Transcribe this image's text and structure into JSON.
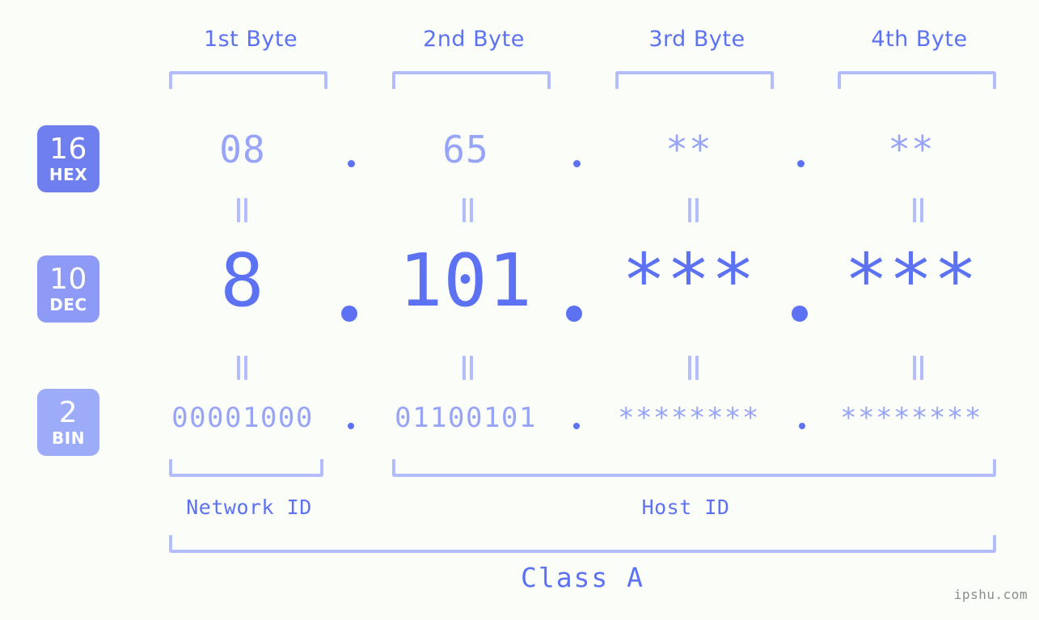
{
  "columns": [
    {
      "header": "1st Byte"
    },
    {
      "header": "2nd Byte"
    },
    {
      "header": "3rd Byte"
    },
    {
      "header": "4th Byte"
    }
  ],
  "rows": {
    "hex": {
      "badge_number": "16",
      "badge_name": "HEX",
      "values": [
        "08",
        "65",
        "**",
        "**"
      ]
    },
    "dec": {
      "badge_number": "10",
      "badge_name": "DEC",
      "values": [
        "8",
        "101",
        "***",
        "***"
      ]
    },
    "bin": {
      "badge_number": "2",
      "badge_name": "BIN",
      "values": [
        "00001000",
        "01100101",
        "********",
        "********"
      ]
    }
  },
  "separator": ".",
  "network_id_label": "Network ID",
  "host_id_label": "Host ID",
  "class_label": "Class A",
  "watermark": "ipshu.com",
  "colors": {
    "background": "#fbfdf8",
    "primary": "#5c72f2",
    "muted": "#97a4f7",
    "bracket": "#b3bdfb",
    "badge_hex": "#6f80ee",
    "badge_dec": "#8e9bf6",
    "badge_bin": "#9cacf8",
    "watermark": "#8d8d8d"
  }
}
